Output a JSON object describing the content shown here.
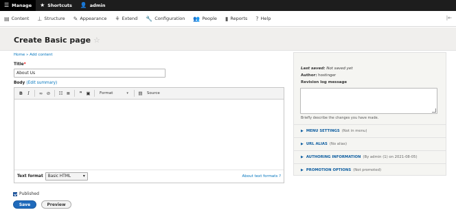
{
  "toolbar": {
    "manage": "Manage",
    "shortcuts": "Shortcuts",
    "user": "admin"
  },
  "admin_menu": {
    "items": [
      {
        "label": "Content",
        "icon": "content-icon"
      },
      {
        "label": "Structure",
        "icon": "structure-icon"
      },
      {
        "label": "Appearance",
        "icon": "appearance-icon"
      },
      {
        "label": "Extend",
        "icon": "extend-icon"
      },
      {
        "label": "Configuration",
        "icon": "wrench-icon"
      },
      {
        "label": "People",
        "icon": "people-icon"
      },
      {
        "label": "Reports",
        "icon": "reports-icon"
      },
      {
        "label": "Help",
        "icon": "help-icon"
      }
    ],
    "collapse_glyph": "|⇤"
  },
  "page": {
    "title": "Create Basic page",
    "breadcrumb": "Home » Add content"
  },
  "form": {
    "title_label": "Title",
    "title_required_mark": "*",
    "title_value": "About Us",
    "body_label": "Body",
    "body_edit_summary": "(Edit summary)",
    "editor": {
      "format_label": "Format",
      "source_label": "Source"
    },
    "text_format_label": "Text format",
    "text_format_value": "Basic HTML",
    "about_text_formats": "About text formats",
    "published_label": "Published",
    "save_label": "Save",
    "preview_label": "Preview"
  },
  "sidebar": {
    "last_saved_label": "Last saved:",
    "last_saved_value": "Not saved yet",
    "author_label": "Author:",
    "author_value": "hostinger",
    "revision_log_label": "Revision log message",
    "revision_hint": "Briefly describe the changes you have made.",
    "sections": [
      {
        "title": "MENU SETTINGS",
        "summary": "(Not in menu)"
      },
      {
        "title": "URL ALIAS",
        "summary": "(No alias)"
      },
      {
        "title": "AUTHORING INFORMATION",
        "summary": "(By admin (1) on 2021-08-05)"
      },
      {
        "title": "PROMOTION OPTIONS",
        "summary": "(Not promoted)"
      }
    ]
  },
  "colors": {
    "topbar_bg": "#1d1d1d",
    "link": "#0074bd",
    "primary_button": "#1f6abb"
  }
}
